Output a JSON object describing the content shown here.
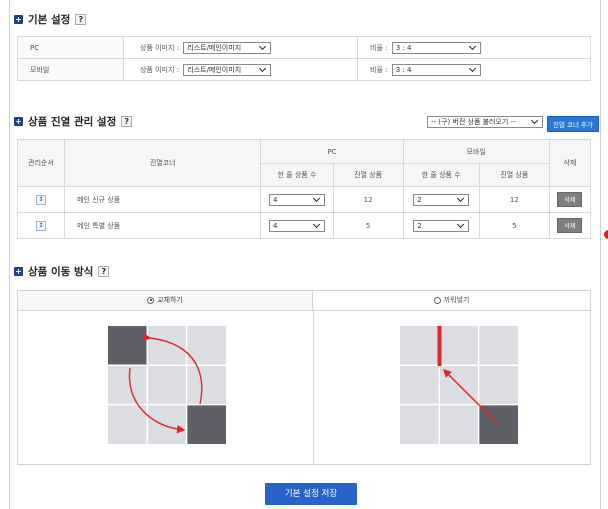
{
  "basic": {
    "title": "기본 설정",
    "help": "?",
    "rows": [
      {
        "device": "PC",
        "image_label": "상품 이미지 :",
        "image_value": "리스트/메인이미지",
        "ratio_label": "비율 :",
        "ratio_value": "3 : 4"
      },
      {
        "device": "모바일",
        "image_label": "상품 이미지 :",
        "image_value": "리스트/메인이미지",
        "ratio_label": "비율 :",
        "ratio_value": "3 : 4"
      }
    ]
  },
  "display": {
    "title": "상품 진열 관리 설정",
    "help": "?",
    "load_select": "-- (구) 버전 상품 불러오기 --",
    "add_button": "진열 코너 추가",
    "headers": {
      "order": "관리순서",
      "corner": "진열코너",
      "pc": "PC",
      "mobile": "모바일",
      "per_row": "한 줄 상품 수",
      "display_count": "진열 상품",
      "delete": "삭제"
    },
    "rows": [
      {
        "order_icon": "↕",
        "name": "메인 신규 상품",
        "pc_per_row": "4",
        "pc_count": "12",
        "mobile_per_row": "2",
        "mobile_count": "12",
        "delete": "삭제"
      },
      {
        "order_icon": "↕",
        "name": "메인 특별 상품",
        "pc_per_row": "4",
        "pc_count": "5",
        "mobile_per_row": "2",
        "mobile_count": "5",
        "delete": "삭제"
      }
    ]
  },
  "move": {
    "title": "상품 이동 방식",
    "help": "?",
    "option_swap": "교체하기",
    "option_insert": "끼워넣기",
    "selected": "swap"
  },
  "save_button": "기본 설정 저장",
  "colors": {
    "accent": "#2864c8",
    "bullet": "#1f3f8c",
    "grid_light": "#dcdde3",
    "grid_dark": "#5e5f67",
    "arrow": "#e0262b"
  }
}
